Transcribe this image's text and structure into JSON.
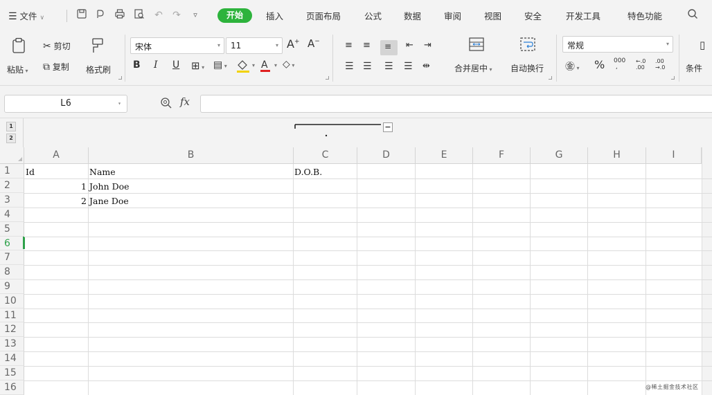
{
  "menu": {
    "items": [
      {
        "label": "文件"
      },
      {
        "label": "开始"
      },
      {
        "label": "插入"
      },
      {
        "label": "页面布局"
      },
      {
        "label": "公式"
      },
      {
        "label": "数据"
      },
      {
        "label": "审阅"
      },
      {
        "label": "视图"
      },
      {
        "label": "安全"
      },
      {
        "label": "开发工具"
      },
      {
        "label": "特色功能"
      }
    ]
  },
  "ribbon": {
    "paste": "粘贴",
    "cut": "剪切",
    "copy": "复制",
    "format_painter": "格式刷",
    "font_name": "宋体",
    "font_size": "11",
    "merge_center": "合并居中",
    "wrap_text": "自动换行",
    "number_format": "常规",
    "percent": "%",
    "conditional": "条件",
    "bold": "B",
    "italic": "I",
    "underline": "U"
  },
  "formula_bar": {
    "name_box": "L6",
    "fx": "fx",
    "formula": ""
  },
  "outline": {
    "levels": [
      "1",
      "2"
    ]
  },
  "sheet": {
    "columns": [
      "A",
      "B",
      "C",
      "D",
      "E",
      "F",
      "G",
      "H",
      "I"
    ],
    "rows": [
      "1",
      "2",
      "3",
      "4",
      "5",
      "6",
      "7",
      "8",
      "9",
      "10",
      "11",
      "12",
      "13",
      "14",
      "15",
      "16"
    ],
    "active_row": "6",
    "cells": {
      "A1": "Id",
      "B1": "Name",
      "C1": "D.O.B.",
      "A2": "1",
      "B2": "John Doe",
      "A3": "2",
      "B3": "Jane Doe"
    }
  },
  "watermark": "@稀土掘金技术社区",
  "colors": {
    "accent_green": "#2db33c",
    "active_row": "#2ea14a"
  }
}
